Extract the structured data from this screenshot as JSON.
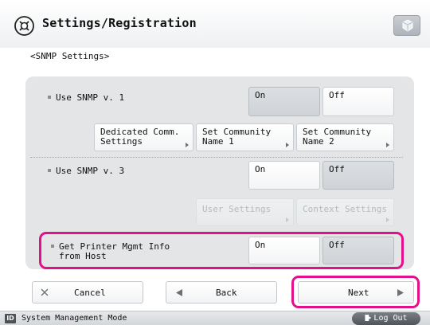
{
  "header": {
    "title": "Settings/Registration",
    "icon": "settings-registration-icon",
    "corner_icon": "cube-icon"
  },
  "subtitle": "<SNMP Settings>",
  "snmp_v1": {
    "label": "Use SNMP v. 1",
    "on": "On",
    "off": "Off",
    "selected": "On",
    "dedicated_line1": "Dedicated Comm.",
    "dedicated_line2": "Settings",
    "community1_line1": "Set Community",
    "community1_line2": "Name 1",
    "community2_line1": "Set Community",
    "community2_line2": "Name 2"
  },
  "snmp_v3": {
    "label": "Use SNMP v. 3",
    "on": "On",
    "off": "Off",
    "selected": "Off",
    "user_settings": "User Settings",
    "context_settings": "Context Settings"
  },
  "printer_mgmt": {
    "label_line1": "Get Printer Mgmt Info",
    "label_line2": "from Host",
    "on": "On",
    "off": "Off",
    "selected": "Off"
  },
  "footer": {
    "cancel": "Cancel",
    "back": "Back",
    "next": "Next"
  },
  "status": {
    "mode_icon": "ID",
    "mode_text": "System Management Mode",
    "logout": "Log Out"
  },
  "colors": {
    "highlight": "#e3108b"
  }
}
